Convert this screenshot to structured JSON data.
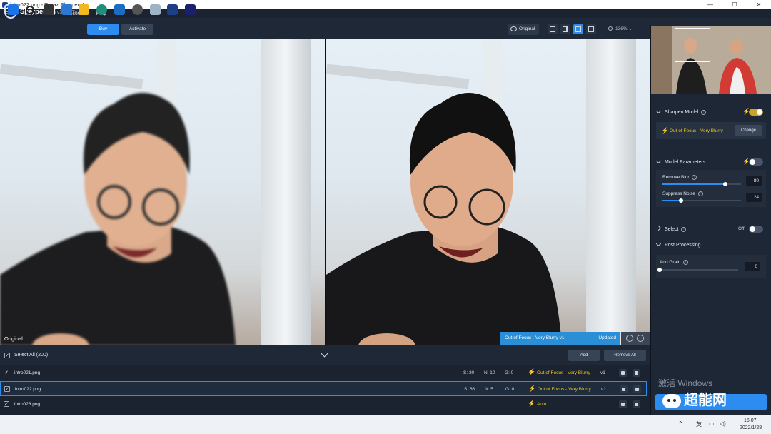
{
  "window": {
    "title": "intro022.png - Topaz Sharpen AI",
    "controls": [
      "—",
      "☐",
      "✕"
    ]
  },
  "menu": [
    "File",
    "Edit",
    "View",
    "Account",
    "Help"
  ],
  "header": {
    "app_name": "Sharpen AI",
    "version": "v3.3.5 Trial",
    "buy_label": "Buy",
    "activate_label": "Activate",
    "original_label": "Original",
    "zoom_label": "136%"
  },
  "preview": {
    "left_caption": "Original",
    "status_model": "Out of Focus - Very Blurry v1",
    "status_text": "Updated"
  },
  "panel": {
    "sharpen_model_label": "Sharpen Model",
    "sharpen_model_on": true,
    "current_model": "Out of Focus - Very Blurry",
    "change_label": "Change",
    "model_params_label": "Model Parameters",
    "model_params_on": false,
    "remove_blur_label": "Remove Blur",
    "remove_blur_value": "80",
    "remove_blur_level": 0.8,
    "suppress_noise_label": "Suppress Noise",
    "suppress_noise_value": "24",
    "suppress_noise_level": 0.24,
    "select_label": "Select",
    "select_state": "Off",
    "post_processing_label": "Post Processing",
    "add_grain_label": "Add Grain",
    "add_grain_value": "0",
    "add_grain_level": 0.0,
    "watermark_text": "激活 Windows",
    "brand_watermark": "超能网"
  },
  "filelist": {
    "select_all_label": "Select All (200)",
    "add_label": "Add",
    "remove_all_label": "Remove All",
    "rows": [
      {
        "name": "intro021.png",
        "s": "S: 30",
        "n": "N: 10",
        "g": "G: 0",
        "model": "Out of Focus - Very Blurry",
        "ver": "v1"
      },
      {
        "name": "intro022.png",
        "s": "S: 66",
        "n": "N: 5",
        "g": "G: 0",
        "model": "Out of Focus - Very Blurry",
        "ver": "v1"
      },
      {
        "name": "intro023.png",
        "s": "",
        "n": "",
        "g": "",
        "model": "Auto",
        "ver": ""
      }
    ]
  },
  "taskbar": {
    "ime": "英",
    "time": "15:07",
    "date": "2022/1/28"
  }
}
